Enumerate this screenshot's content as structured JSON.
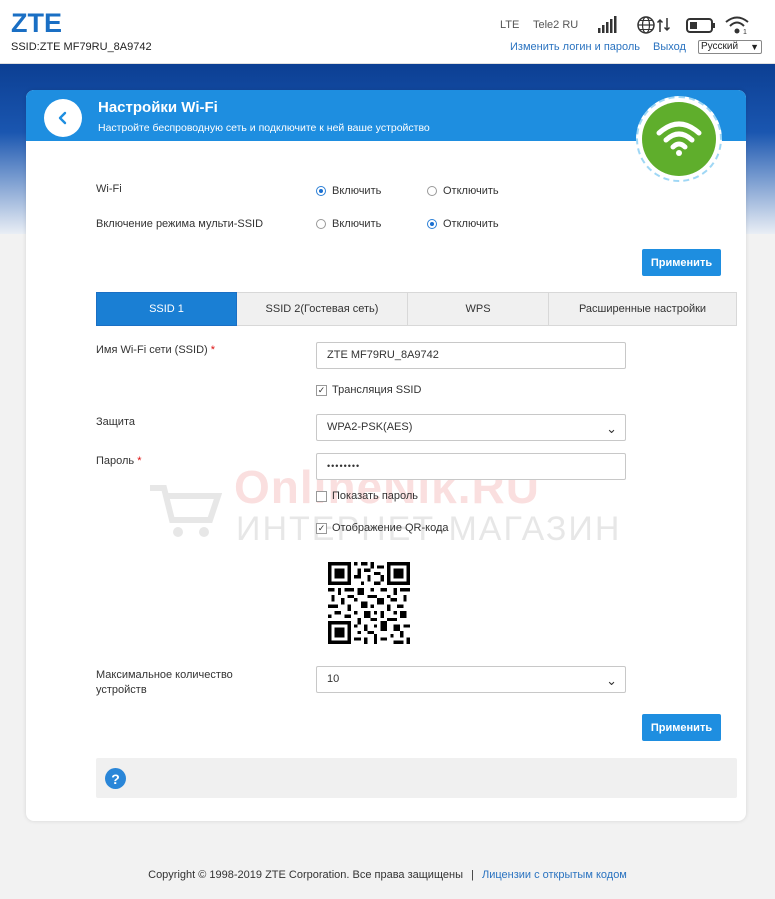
{
  "header": {
    "logo": "ZTE",
    "ssid": "SSID:ZTE MF79RU_8A9742",
    "network_type": "LTE",
    "operator": "Tele2 RU",
    "change_login_link": "Изменить логин и пароль",
    "logout_link": "Выход",
    "language": "Русский"
  },
  "card": {
    "title": "Настройки Wi-Fi",
    "subtitle": "Настройте беспроводную сеть и подключите к ней ваше устройство"
  },
  "general": {
    "wifi_label": "Wi-Fi",
    "wifi_on": "Включить",
    "wifi_off": "Отключить",
    "wifi_state": "on",
    "multi_ssid_label": "Включение режима мульти-SSID",
    "multi_on": "Включить",
    "multi_off": "Отключить",
    "multi_state": "off",
    "apply": "Применить"
  },
  "tabs": [
    {
      "label": "SSID 1",
      "active": true
    },
    {
      "label": "SSID 2(Гостевая сеть)",
      "active": false
    },
    {
      "label": "WPS",
      "active": false
    },
    {
      "label": "Расширенные настройки",
      "active": false
    }
  ],
  "ssid_form": {
    "ssid_label": "Имя Wi-Fi сети (SSID)",
    "ssid_value": "ZTE MF79RU_8A9742",
    "broadcast_label": "Трансляция SSID",
    "broadcast_checked": true,
    "security_label": "Защита",
    "security_value": "WPA2-PSK(AES)",
    "password_label": "Пароль",
    "password_value": "••••••••",
    "show_password_label": "Показать пароль",
    "show_password_checked": false,
    "qr_label": "Отображение QR-кода",
    "qr_checked": true,
    "max_devices_label_1": "Максимальное количество",
    "max_devices_label_2": "устройств",
    "max_devices_value": "10",
    "apply": "Применить",
    "required_mark": "*"
  },
  "watermark": {
    "main": "OnlineNik.RU",
    "sub": "ИНТЕРНЕТ-МАГАЗИН"
  },
  "help": {
    "icon": "?"
  },
  "footer": {
    "copyright": "Copyright © 1998-2019 ZTE Corporation. Все права защищены",
    "separator": "|",
    "license_link": "Лицензии с открытым кодом"
  },
  "colors": {
    "accent": "#1e8ee0",
    "wifi_badge": "#5fae2c",
    "header_band": "#0c3f93"
  }
}
